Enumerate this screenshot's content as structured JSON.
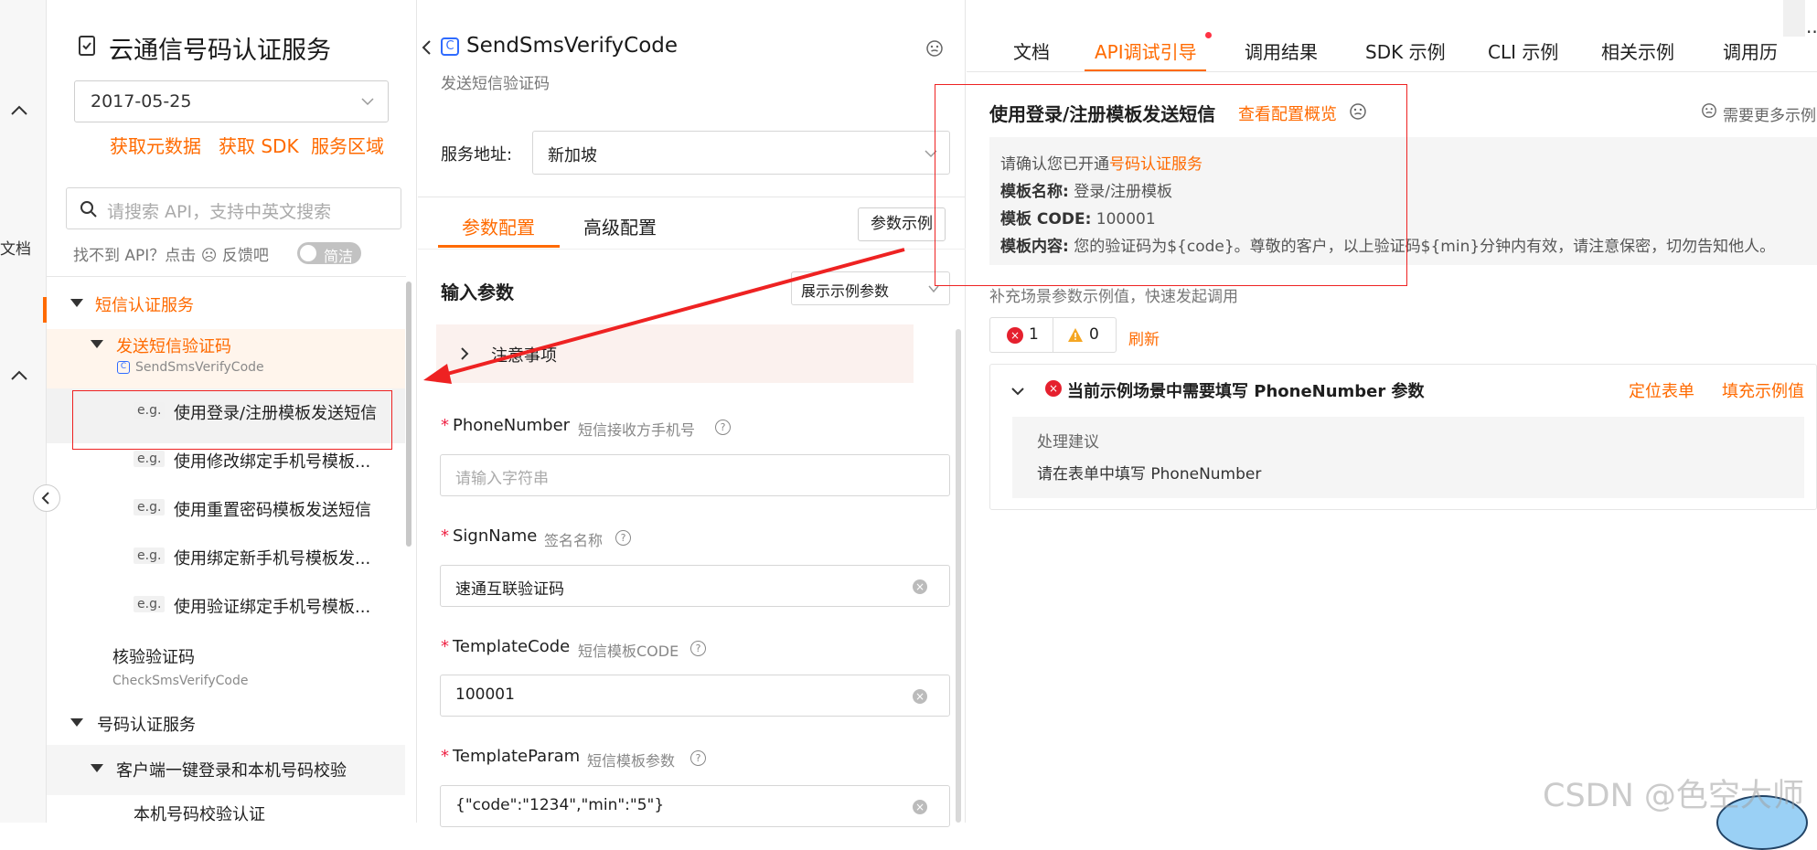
{
  "rail": {
    "doc_label": "文档"
  },
  "sidebar": {
    "service_title": "云通信号码认证服务",
    "version": "2017-05-25",
    "links": [
      "获取元数据",
      "获取 SDK",
      "服务区域"
    ],
    "search_placeholder": "请搜索 API，支持中英文搜索",
    "help_text": "找不到 API？点击 ☹ 反馈吧",
    "toggle_label": "简洁",
    "tree": {
      "group1": "短信认证服务",
      "api1": {
        "label": "发送短信验证码",
        "code": "SendSmsVerifyCode"
      },
      "eg_tag": "e.g.",
      "examples": [
        "使用登录/注册模板发送短信",
        "使用修改绑定手机号模板...",
        "使用重置密码模板发送短信",
        "使用绑定新手机号模板发...",
        "使用验证绑定手机号模板..."
      ],
      "api2": {
        "label": "核验验证码",
        "code": "CheckSmsVerifyCode"
      },
      "group2": "号码认证服务",
      "sub_group": "客户端一键登录和本机号码校验",
      "api3": "本机号码校验认证"
    }
  },
  "middle": {
    "api_icon": "C",
    "api_name": "SendSmsVerifyCode",
    "api_desc": "发送短信验证码",
    "addr_label": "服务地址:",
    "addr_value": "新加坡",
    "tabs": [
      "参数配置",
      "高级配置"
    ],
    "example_button": "参数示例",
    "input_title": "输入参数",
    "show_example": "展示示例参数",
    "notice": "注意事项",
    "params": [
      {
        "name": "PhoneNumber",
        "desc": "短信接收方手机号",
        "value": "",
        "placeholder": "请输入字符串"
      },
      {
        "name": "SignName",
        "desc": "签名名称",
        "value": "速通互联验证码"
      },
      {
        "name": "TemplateCode",
        "desc": "短信模板CODE",
        "value": "100001"
      },
      {
        "name": "TemplateParam",
        "desc": "短信模板参数",
        "value": "{\"code\":\"1234\",\"min\":\"5\"}"
      }
    ]
  },
  "right": {
    "tabs": [
      "文档",
      "API调试引导",
      "调用结果",
      "SDK 示例",
      "CLI 示例",
      "相关示例",
      "调用历"
    ],
    "more": "··",
    "scene_title": "使用登录/注册模板发送短信",
    "config_link": "查看配置概览",
    "need_more": "需要更多示例",
    "info": {
      "line1_prefix": "请确认您已开通",
      "line1_link": "号码认证服务",
      "line2_label": "模板名称:",
      "line2_value": "登录/注册模板",
      "line3_label": "模板 CODE:",
      "line3_value": "100001",
      "line4_label": "模板内容:",
      "line4_value": "您的验证码为${code}。尊敬的客户，以上验证码${min}分钟内有效，请注意保密，切勿告知他人。"
    },
    "fill_hint": "补充场景参数示例值，快速发起调用",
    "error_count": "1",
    "warn_count": "0",
    "refresh": "刷新",
    "issue_title": "当前示例场景中需要填写 PhoneNumber 参数",
    "locate_link": "定位表单",
    "fill_link": "填充示例值",
    "advice_title": "处理建议",
    "advice_text": "请在表单中填写 PhoneNumber"
  },
  "watermark": "CSDN @色空大师",
  "colors": {
    "accent": "#ff6a00",
    "annotation_red": "#e22222",
    "error_red": "#e5202e",
    "link_blue": "#2f6bff"
  }
}
